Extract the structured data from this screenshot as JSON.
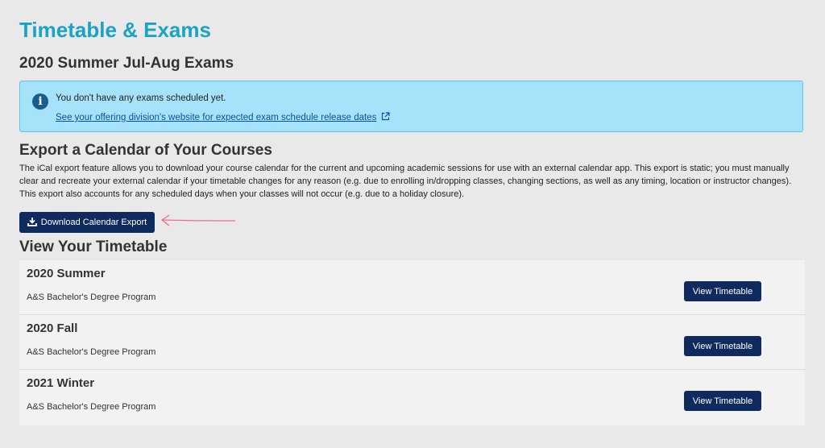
{
  "page": {
    "title": "Timetable & Exams"
  },
  "exams": {
    "heading": "2020 Summer Jul-Aug Exams",
    "notice_text": "You don't have any exams scheduled yet.",
    "notice_link": "See your offering division's website for expected exam schedule release dates",
    "notice_icon": "info-circle-icon",
    "link_icon": "external-link-icon"
  },
  "export": {
    "heading": "Export a Calendar of Your Courses",
    "description": "The iCal export feature allows you to download your course calendar for the current and upcoming academic sessions for use with an external calendar app. This export is static; you must manually clear and recreate your external calendar if your timetable changes for any reason (e.g. due to enrolling in/dropping classes, changing sections, as well as any timing, location or instructor changes). This export also accounts for any scheduled days when your classes will not occur (e.g. due to a holiday closure).",
    "button_label": "Download Calendar Export",
    "button_icon": "download-icon"
  },
  "timetable": {
    "heading": "View Your Timetable",
    "sessions": [
      {
        "session": "2020 Summer",
        "program": "A&S Bachelor's Degree Program",
        "button_label": "View Timetable"
      },
      {
        "session": "2020 Fall",
        "program": "A&S Bachelor's Degree Program",
        "button_label": "View Timetable"
      },
      {
        "session": "2021 Winter",
        "program": "A&S Bachelor's Degree Program",
        "button_label": "View Timetable"
      }
    ]
  },
  "colors": {
    "title": "#1aa3c4",
    "info_bg": "#a6e3fb",
    "button_bg": "#0e2a5f",
    "annotation_arrow": "#f06b9c"
  }
}
